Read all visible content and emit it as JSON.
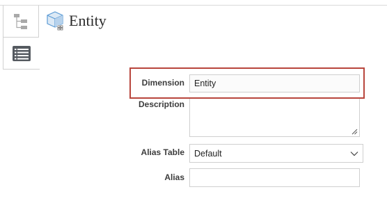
{
  "header": {
    "title": "Entity",
    "title_icon": "cube-entity-icon"
  },
  "side_tabs": [
    {
      "name": "hierarchy",
      "icon": "hierarchy-tree-icon"
    },
    {
      "name": "properties",
      "icon": "properties-list-icon",
      "selected": true
    }
  ],
  "form": {
    "dimension": {
      "label": "Dimension",
      "value": "Entity"
    },
    "description": {
      "label": "Description",
      "value": ""
    },
    "alias_table": {
      "label": "Alias Table",
      "value": "Default"
    },
    "alias": {
      "label": "Alias",
      "value": ""
    }
  },
  "colors": {
    "highlight": "#b8453c",
    "icon_gray": "#666666",
    "cube_blue": "#5b9bd5"
  }
}
